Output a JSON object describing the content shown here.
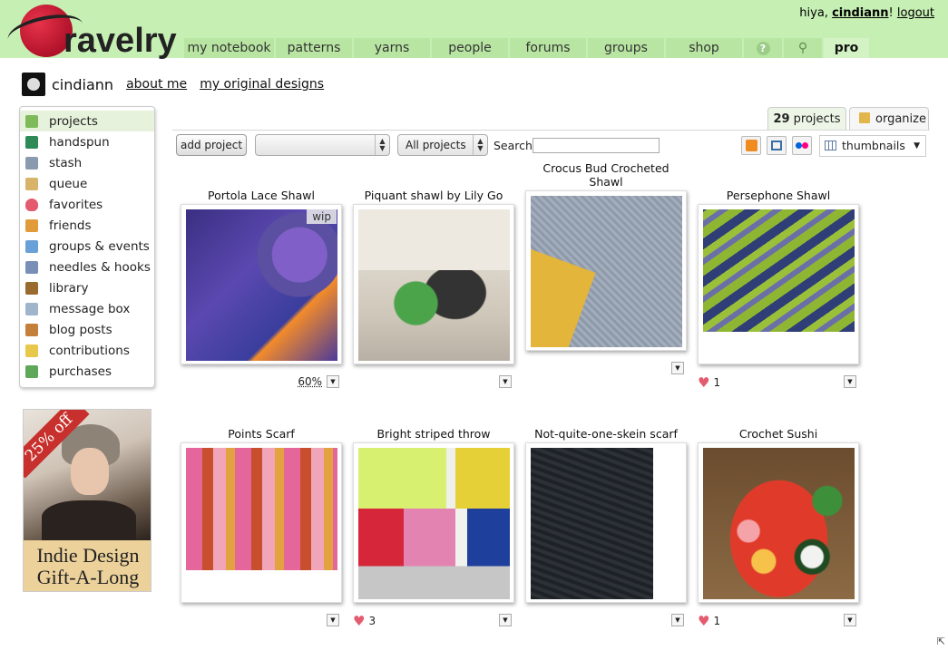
{
  "header": {
    "logo_text": "ravelry",
    "greeting": "hiya, ",
    "username": "cindiann",
    "greeting_suffix": "!",
    "logout_label": "logout",
    "nav": [
      {
        "label": "my notebook",
        "width": 99
      },
      {
        "label": "patterns",
        "width": 84
      },
      {
        "label": "yarns",
        "width": 84
      },
      {
        "label": "people",
        "width": 84
      },
      {
        "label": "forums",
        "width": 84
      },
      {
        "label": "groups",
        "width": 84
      },
      {
        "label": "shop",
        "width": 84
      }
    ],
    "help_icon": "question-icon",
    "search_icon": "magnifier-icon",
    "pro_label": "pro"
  },
  "profile": {
    "name": "cindiann",
    "about_label": "about me",
    "designs_label": "my original designs"
  },
  "sidebar": {
    "items": [
      {
        "label": "projects",
        "icon": "projects-grid-icon",
        "color": "#7dbb5a",
        "active": true
      },
      {
        "label": "handspun",
        "icon": "spool-icon",
        "color": "#2e8b57"
      },
      {
        "label": "stash",
        "icon": "basket-icon",
        "color": "#8a9bb0"
      },
      {
        "label": "queue",
        "icon": "list-icon",
        "color": "#d8b46a"
      },
      {
        "label": "favorites",
        "icon": "heart-icon",
        "color": "#e45a6e"
      },
      {
        "label": "friends",
        "icon": "people-icon",
        "color": "#e29b3b"
      },
      {
        "label": "groups & events",
        "icon": "groups-icon",
        "color": "#6aa0d8"
      },
      {
        "label": "needles & hooks",
        "icon": "needles-icon",
        "color": "#7a8fb8"
      },
      {
        "label": "library",
        "icon": "books-icon",
        "color": "#9a6b2f"
      },
      {
        "label": "message box",
        "icon": "envelope-icon",
        "color": "#a0b4cc"
      },
      {
        "label": "blog posts",
        "icon": "house-icon",
        "color": "#c47f3a"
      },
      {
        "label": "contributions",
        "icon": "pencil-icon",
        "color": "#e8c84a"
      },
      {
        "label": "purchases",
        "icon": "money-icon",
        "color": "#5fa85a"
      }
    ]
  },
  "ad": {
    "sash_text": "25% off",
    "caption": "Indie Design Gift-A-Long"
  },
  "tabs": {
    "count": "29",
    "count_label": " projects",
    "organize_label": "organize"
  },
  "toolbar": {
    "add_project_label": "add project",
    "collection_value": "",
    "filter_value": "All projects",
    "search_label": "Search",
    "search_value": "",
    "view_value": "thumbnails",
    "icons": [
      "rss-icon",
      "slideshow-icon",
      "flickr-icon"
    ]
  },
  "projects": [
    {
      "title": "Portola Lace Shawl",
      "badge": "wip",
      "progress": "60%",
      "hearts": ""
    },
    {
      "title": "Piquant shawl by Lily Go",
      "badge": "",
      "progress": "",
      "hearts": ""
    },
    {
      "title": "Crocus Bud Crocheted Shawl",
      "badge": "",
      "progress": "",
      "hearts": ""
    },
    {
      "title": "Persephone Shawl",
      "badge": "",
      "progress": "",
      "hearts": "1"
    },
    {
      "title": "Points Scarf",
      "badge": "",
      "progress": "",
      "hearts": ""
    },
    {
      "title": "Bright striped throw",
      "badge": "",
      "progress": "",
      "hearts": "3"
    },
    {
      "title": "Not-quite-one-skein scarf",
      "badge": "",
      "progress": "",
      "hearts": ""
    },
    {
      "title": "Crochet Sushi",
      "badge": "",
      "progress": "",
      "hearts": "1"
    }
  ]
}
